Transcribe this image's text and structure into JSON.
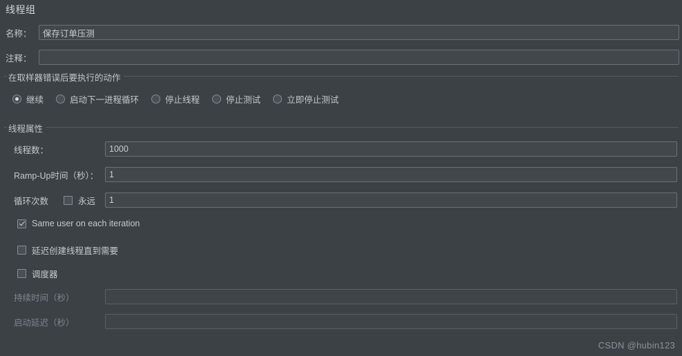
{
  "window": {
    "title": "线程组",
    "background": "#3c4146",
    "text_color": "#c5c9cd"
  },
  "fields": {
    "name_label": "名称：",
    "name_value": "保存订单压测",
    "comment_label": "注释：",
    "comment_value": ""
  },
  "error_action_group": {
    "legend": "在取样器错误后要执行的动作",
    "options": [
      {
        "label": "继续",
        "selected": true
      },
      {
        "label": "启动下一进程循环",
        "selected": false
      },
      {
        "label": "停止线程",
        "selected": false
      },
      {
        "label": "停止测试",
        "selected": false
      },
      {
        "label": "立即停止测试",
        "selected": false
      }
    ]
  },
  "thread_properties": {
    "legend": "线程属性",
    "thread_count_label": "线程数：",
    "thread_count_value": "1000",
    "ramp_up_label": "Ramp-Up时间（秒）：",
    "ramp_up_value": "1",
    "loop_count_label": "循环次数",
    "forever_label": "永远",
    "forever_checked": false,
    "loop_count_value": "1",
    "same_user_label": "Same user on each iteration",
    "same_user_checked": true,
    "delay_create_label": "延迟创建线程直到需要",
    "delay_create_checked": false,
    "scheduler_label": "调度器",
    "scheduler_checked": false,
    "duration_label": "持续时间（秒）",
    "duration_value": "",
    "startup_delay_label": "启动延迟（秒）",
    "startup_delay_value": ""
  },
  "watermark": {
    "text": "CSDN @hubin123"
  }
}
